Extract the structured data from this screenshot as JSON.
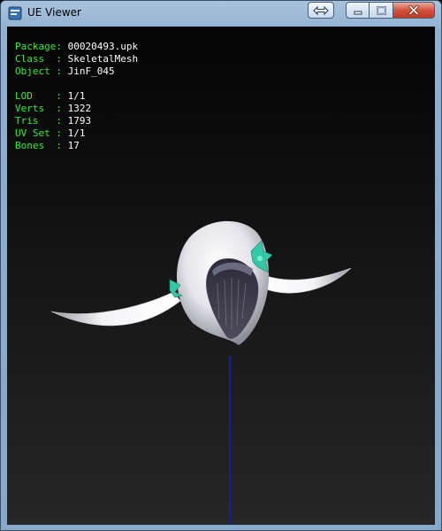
{
  "window": {
    "title": "UE Viewer",
    "buttons": {
      "swap": "swap-icon",
      "minimize": "minimize-icon",
      "maximize": "maximize-icon",
      "close": "close-icon"
    }
  },
  "info": {
    "package_label": "Package",
    "package": "00020493.upk",
    "class_label": "Class",
    "class": "SkeletalMesh",
    "object_label": "Object",
    "object": "JinF_045",
    "lod_label": "LOD",
    "lod": "1/1",
    "verts_label": "Verts",
    "verts": "1322",
    "tris_label": "Tris",
    "tris": "1793",
    "uvset_label": "UV Set",
    "uvset": "1/1",
    "bones_label": "Bones",
    "bones": "17"
  },
  "colors": {
    "label": "#33ee33",
    "value": "#ffffff",
    "bone_axis": "#1a1aa8",
    "ribbon": "#34c9a6"
  }
}
